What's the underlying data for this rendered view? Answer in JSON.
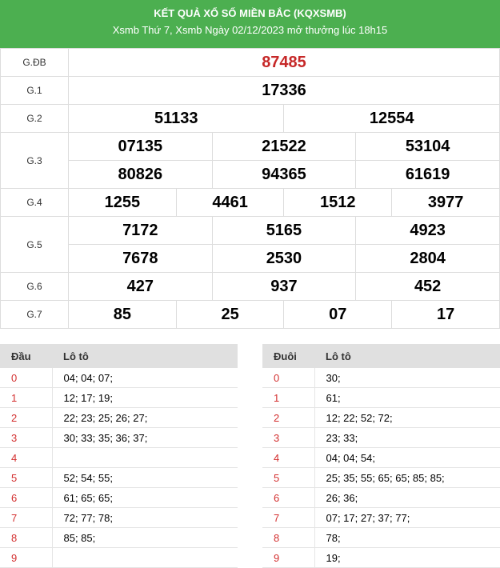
{
  "header": {
    "title": "KẾT QUẢ XỔ SỐ MIỀN BẮC (KQXSMB)",
    "subtitle": "Xsmb Thứ 7, Xsmb Ngày 02/12/2023 mở thưởng lúc 18h15"
  },
  "results": {
    "db": {
      "label": "G.ĐB",
      "values": [
        "87485"
      ]
    },
    "g1": {
      "label": "G.1",
      "values": [
        "17336"
      ]
    },
    "g2": {
      "label": "G.2",
      "values": [
        "51133",
        "12554"
      ]
    },
    "g3": {
      "label": "G.3",
      "values": [
        "07135",
        "21522",
        "53104",
        "80826",
        "94365",
        "61619"
      ]
    },
    "g4": {
      "label": "G.4",
      "values": [
        "1255",
        "4461",
        "1512",
        "3977"
      ]
    },
    "g5": {
      "label": "G.5",
      "values": [
        "7172",
        "5165",
        "4923",
        "7678",
        "2530",
        "2804"
      ]
    },
    "g6": {
      "label": "G.6",
      "values": [
        "427",
        "937",
        "452"
      ]
    },
    "g7": {
      "label": "G.7",
      "values": [
        "85",
        "25",
        "07",
        "17"
      ]
    }
  },
  "dau": {
    "h1": "Đầu",
    "h2": "Lô tô",
    "rows": [
      {
        "k": "0",
        "v": "04; 04; 07;"
      },
      {
        "k": "1",
        "v": "12; 17; 19;"
      },
      {
        "k": "2",
        "v": "22; 23; 25; 26; 27;"
      },
      {
        "k": "3",
        "v": "30; 33; 35; 36; 37;"
      },
      {
        "k": "4",
        "v": ""
      },
      {
        "k": "5",
        "v": "52; 54; 55;"
      },
      {
        "k": "6",
        "v": "61; 65; 65;"
      },
      {
        "k": "7",
        "v": "72; 77; 78;"
      },
      {
        "k": "8",
        "v": "85; 85;"
      },
      {
        "k": "9",
        "v": ""
      }
    ]
  },
  "duoi": {
    "h1": "Đuôi",
    "h2": "Lô tô",
    "rows": [
      {
        "k": "0",
        "v": "30;"
      },
      {
        "k": "1",
        "v": "61;"
      },
      {
        "k": "2",
        "v": "12; 22; 52; 72;"
      },
      {
        "k": "3",
        "v": "23; 33;"
      },
      {
        "k": "4",
        "v": "04; 04; 54;"
      },
      {
        "k": "5",
        "v": "25; 35; 55; 65; 65; 85; 85;"
      },
      {
        "k": "6",
        "v": "26; 36;"
      },
      {
        "k": "7",
        "v": "07; 17; 27; 37; 77;"
      },
      {
        "k": "8",
        "v": "78;"
      },
      {
        "k": "9",
        "v": "19;"
      }
    ]
  }
}
